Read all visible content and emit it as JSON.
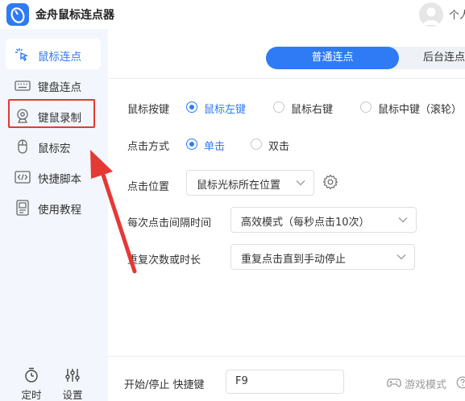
{
  "app": {
    "title": "金舟鼠标连点器",
    "logo_icon": "mouse-logo-icon",
    "user_text": "个人"
  },
  "sidebar": {
    "items": [
      {
        "label": "鼠标连点",
        "icon": "mouse-click-icon",
        "active": true
      },
      {
        "label": "键盘连点",
        "icon": "keyboard-icon",
        "active": false
      },
      {
        "label": "键鼠录制",
        "icon": "webcam-record-icon",
        "active": false
      },
      {
        "label": "鼠标宏",
        "icon": "mouse-icon",
        "active": false
      },
      {
        "label": "快捷脚本",
        "icon": "code-script-icon",
        "active": false
      },
      {
        "label": "使用教程",
        "icon": "tutorial-doc-icon",
        "active": false
      }
    ],
    "bottom": [
      {
        "label": "定时",
        "icon": "timer-icon"
      },
      {
        "label": "设置",
        "icon": "sliders-settings-icon"
      }
    ]
  },
  "main": {
    "tabs": [
      {
        "label": "普通连点",
        "active": true
      },
      {
        "label": "后台连点",
        "active": false
      }
    ],
    "mouse_button": {
      "label": "鼠标按键",
      "options": [
        "鼠标左键",
        "鼠标右键",
        "鼠标中键（滚轮）"
      ],
      "selected": 0
    },
    "click_mode": {
      "label": "点击方式",
      "options": [
        "单击",
        "双击"
      ],
      "selected": 0
    },
    "click_position": {
      "label": "点击位置",
      "value": "鼠标光标所在位置"
    },
    "interval": {
      "label": "每次点击间隔时间",
      "value": "高效模式（每秒点击10次）"
    },
    "repeat": {
      "label": "重复次数或时长",
      "value": "重复点击直到手动停止"
    },
    "hotkey": {
      "label": "开始/停止 快捷键",
      "value": "F9"
    },
    "game_mode": {
      "label": "游戏模式"
    }
  },
  "colors": {
    "accent": "#2f7bf5",
    "sidebar_bg": "#f3f7fd",
    "annotation_red": "#e53935"
  }
}
